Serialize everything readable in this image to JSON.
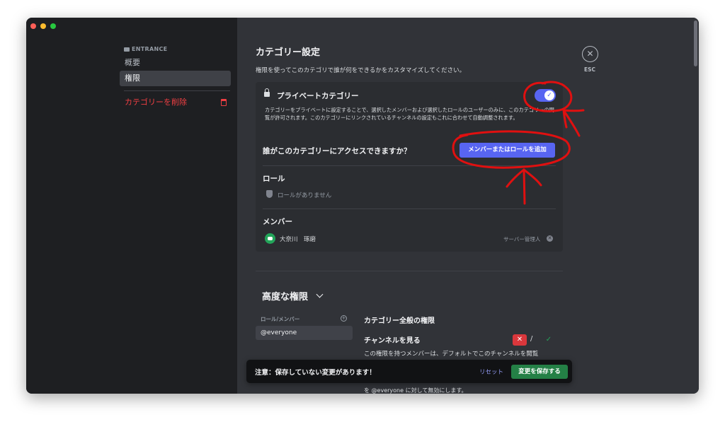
{
  "window": {
    "traffic_lights": [
      "close",
      "minimize",
      "maximize"
    ]
  },
  "sidebar": {
    "section_label": "ENTRANCE",
    "items": [
      {
        "label": "概要",
        "active": false
      },
      {
        "label": "権限",
        "active": true
      }
    ],
    "delete_label": "カテゴリーを削除",
    "delete_icon": "trash-icon"
  },
  "header": {
    "title": "カテゴリー設定",
    "description": "権限を使ってこのカテゴリで誰が何をできるかをカスタマイズしてください。",
    "close_icon": "✕",
    "close_hint": "ESC"
  },
  "private_category": {
    "title": "プライベートカテゴリー",
    "description": "カテゴリーをプライベートに設定することで、選択したメンバーおよび選択したロールのユーザーのみに、このカテゴリーの閲覧が許可されます。このカテゴリーにリンクされているチャンネルの設定もこれに合わせて自動調整されます。",
    "enabled": true,
    "toggle_glyph": "✓"
  },
  "access": {
    "question": "誰がこのカテゴリーにアクセスできますか？",
    "add_button": "メンバーまたはロールを追加",
    "roles_heading": "ロール",
    "no_roles": "ロールがありません",
    "members_heading": "メンバー",
    "members": [
      {
        "name": "大奈川　琢磨",
        "role": "サーバー管理人",
        "remove_glyph": "✕"
      }
    ]
  },
  "advanced": {
    "title": "高度な権限",
    "roles_members_label": "ロール/メンバー",
    "add_glyph": "+",
    "selected_role": "@everyone",
    "section": "カテゴリー全般の権限",
    "permission_name": "チャンネルを見る",
    "deny_glyph": "✕",
    "separator": "/",
    "allow_glyph": "✓",
    "permission_desc": "この権限を持つメンバーは、デフォルトでこのチャンネルを閲覧",
    "permission_desc_tail": "を @everyone に対して無効にします。"
  },
  "save_bar": {
    "message": "注意：保存していない変更があります！",
    "reset_label": "リセット",
    "save_label": "変更を保存する"
  },
  "colors": {
    "accent": "#5865f2",
    "danger": "#f23f43",
    "success": "#248046",
    "annotation": "#e01010"
  }
}
